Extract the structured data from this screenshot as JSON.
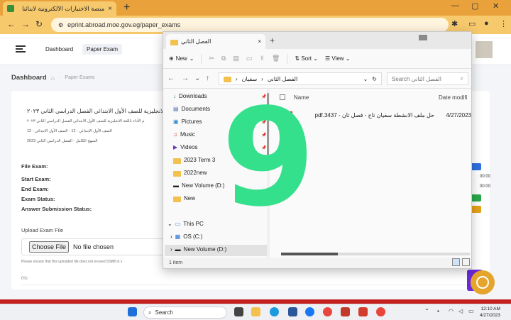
{
  "browser": {
    "tab_title": "منصة الاختبارات الالكترونية لابنائنا",
    "tab_close": "×",
    "new_tab": "+",
    "url": "eprint.abroad.moe.gov.eg/paper_exams"
  },
  "nav": {
    "links": [
      "Dashboard",
      "Paper Exam"
    ]
  },
  "breadcrumb": {
    "title": "Dashboard",
    "separator": "·",
    "sub": "Paper Exams"
  },
  "exam": {
    "title_lines": [
      "الانجليزية للصف الأول الابتدائي الفصل الدراسي الثاني ٢٠٢٣",
      "م الأداء باللغة الانجليزية للصف الأول الابتدائي الفصل الدراسي الثاني ٢٠٢٣",
      "الصف الأول الابتدائي - 12 - الصف الأول الابتدائي - 12",
      "المنهج الكامل - الفصل الدراسي الثاني 2023"
    ],
    "fields": [
      "File Exam:",
      "Start Exam:",
      "End Exam:",
      "Exam Status:",
      "Answer Submission Status:"
    ],
    "upload_label": "Upload Exam File",
    "choose_button": "Choose File",
    "no_file": "No file chosen",
    "note": "Please ensure that this uploaded file does not exceed 50MB in s",
    "percent": "0%",
    "right_values": [
      "00:00",
      "00:00"
    ]
  },
  "explorer": {
    "tab_label": "الفصل الثاني",
    "tab_close": "×",
    "new_tab": "+",
    "toolbar": {
      "new": "New",
      "sort": "Sort",
      "view": "View"
    },
    "path": [
      "سفيان",
      "الفصل الثاني"
    ],
    "search_placeholder": "Search الفصل الثاني",
    "sidebar": [
      "Downloads",
      "Documents",
      "Pictures",
      "Music",
      "Videos",
      "2023 Term 3",
      "2022new",
      "New Volume (D:)",
      "New",
      "This PC",
      "OS (C:)",
      "New Volume (D:)"
    ],
    "columns": {
      "name": "Name",
      "date": "Date modifi"
    },
    "files": [
      {
        "name": "حل ملف الانشطة سفيان تاج - فصل ثان - 3437.pdf",
        "date": "4/27/2023"
      }
    ],
    "status": "1 item"
  },
  "overlay": {
    "text": "9"
  },
  "taskbar": {
    "search": "Search",
    "time": "12:10 AM",
    "date": "4/27/2023"
  },
  "colors": {
    "accent": "#e9a23b",
    "overlay": "#35e08c",
    "fab": "#e5a52d"
  }
}
